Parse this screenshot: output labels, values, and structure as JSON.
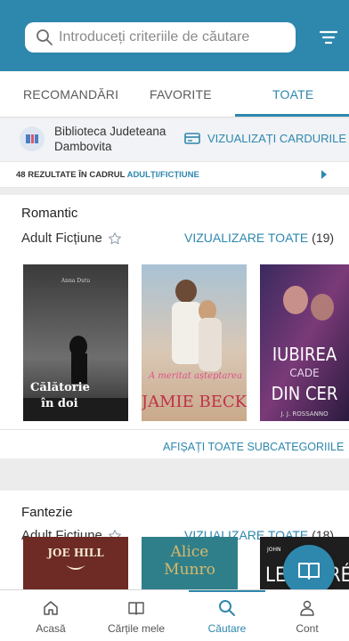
{
  "search": {
    "placeholder": "Introduceți criteriile de căutare"
  },
  "tabs": [
    {
      "label": "RECOMANDĂRI",
      "active": false
    },
    {
      "label": "FAVORITE",
      "active": false
    },
    {
      "label": "TOATE",
      "active": true
    }
  ],
  "library": {
    "name": "Biblioteca Judeteana Dambovita",
    "view_cards_label": "VIZUALIZAȚI CARDURILE"
  },
  "results": {
    "prefix": "48 REZULTATE ÎN CADRUL",
    "category": "ADULȚI/FICȚIUNE"
  },
  "sections": [
    {
      "title": "Romantic",
      "subcategory": "Adult Ficțiune",
      "view_all_label": "VIZUALIZARE TOATE",
      "count": "(19)",
      "show_subcategories_label": "AFIȘAȚI TOATE SUBCATEGORIILE",
      "books": [
        {
          "author": "Anna Dutu",
          "title_line1": "Călătorie",
          "title_line2": "în doi"
        },
        {
          "title": "A meritat așteptarea",
          "author": "JAMIE BECK"
        },
        {
          "title_line1": "IUBIREA",
          "title_line2": "CADE",
          "title_line3": "DIN CER",
          "author": "J. J. ROSSANNO"
        }
      ]
    },
    {
      "title": "Fantezie",
      "subcategory": "Adult Ficțiune",
      "view_all_label": "VIZUALIZARE TOATE",
      "count": "(18)",
      "books": [
        {
          "author": "JOE HILL"
        },
        {
          "author_line1": "Alice",
          "author_line2": "Munro"
        },
        {
          "author_small": "JOHN",
          "author": "LE CARRÉ"
        }
      ]
    }
  ],
  "bottom_nav": [
    {
      "label": "Acasă",
      "icon": "home-icon",
      "active": false
    },
    {
      "label": "Cărțile mele",
      "icon": "book-icon",
      "active": false
    },
    {
      "label": "Căutare",
      "icon": "search-icon",
      "active": true
    },
    {
      "label": "Cont",
      "icon": "user-icon",
      "active": false
    }
  ],
  "colors": {
    "accent": "#2e87ad",
    "header": "#2e87ad"
  }
}
